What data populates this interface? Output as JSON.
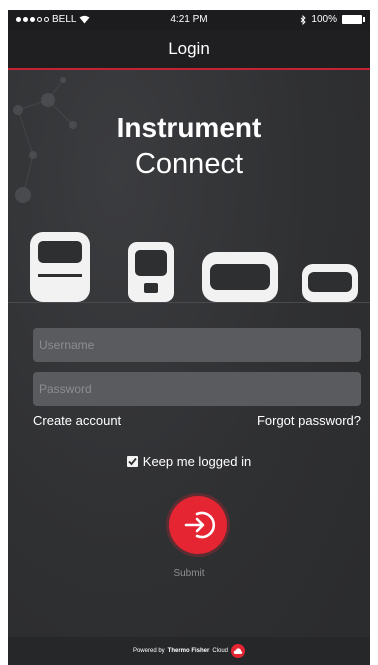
{
  "status_bar": {
    "carrier": "BELL",
    "time": "4:21 PM",
    "battery": "100%"
  },
  "nav": {
    "title": "Login"
  },
  "app": {
    "title_line1": "Instrument",
    "title_line2": "Connect"
  },
  "form": {
    "username_placeholder": "Username",
    "password_placeholder": "Password",
    "create_account": "Create account",
    "forgot_password": "Forgot password?",
    "keep_logged_in": "Keep me logged in",
    "keep_logged_in_checked": true,
    "submit_label": "Submit"
  },
  "footer": {
    "powered_by": "Powered by",
    "brand": "Thermo Fisher",
    "cloud": "Cloud"
  },
  "icons": {
    "wifi": "wifi-icon",
    "bluetooth": "bluetooth-icon",
    "battery": "battery-icon",
    "submit": "arrow-into-circle-icon",
    "check": "checkmark-icon",
    "cloud_logo": "cloud-logo-icon"
  },
  "colors": {
    "accent_red": "#e52532",
    "nav_underline": "#c62332",
    "background": "#2e2f31",
    "field": "#5a5b5e"
  }
}
